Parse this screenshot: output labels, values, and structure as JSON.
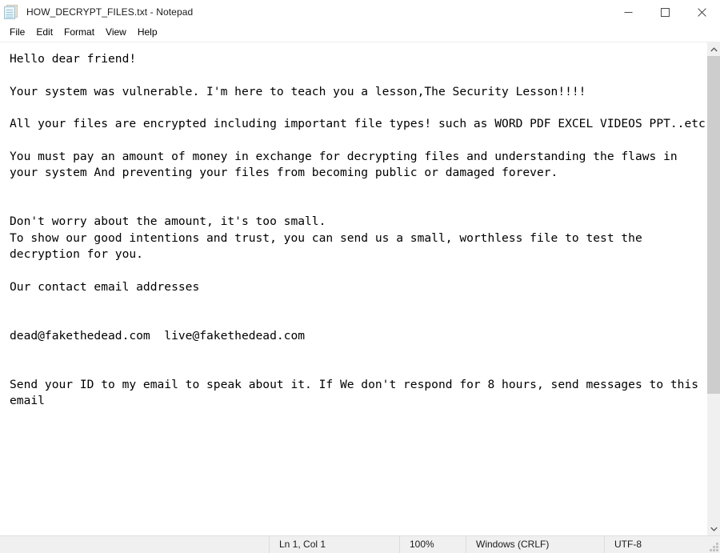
{
  "window": {
    "title": "HOW_DECRYPT_FILES.txt - Notepad",
    "icon": "notepad-icon",
    "controls": [
      {
        "name": "minimize",
        "glyph": "minimize-icon"
      },
      {
        "name": "maximize",
        "glyph": "maximize-icon"
      },
      {
        "name": "close",
        "glyph": "close-icon"
      }
    ]
  },
  "menubar": {
    "items": [
      {
        "label": "File"
      },
      {
        "label": "Edit"
      },
      {
        "label": "Format"
      },
      {
        "label": "View"
      },
      {
        "label": "Help"
      }
    ]
  },
  "document": {
    "body": "Hello dear friend!\n\nYour system was vulnerable. I'm here to teach you a lesson,The Security Lesson!!!!\n\nAll your files are encrypted including important file types! such as WORD PDF EXCEL VIDEOS PPT..etc\n\nYou must pay an amount of money in exchange for decrypting files and understanding the flaws in your system And preventing your files from becoming public or damaged forever.\n\n\nDon't worry about the amount, it's too small.\nTo show our good intentions and trust, you can send us a small, worthless file to test the decryption for you.\n\nOur contact email addresses\n\n\ndead@fakethedead.com  live@fakethedead.com\n\n\nSend your ID to my email to speak about it. If We don't respond for 8 hours, send messages to this email",
    "emails": [
      "dead@fakethedead.com",
      "live@fakethedead.com"
    ]
  },
  "scrollbar": {
    "up_arrow": "chevron-up-icon",
    "down_arrow": "chevron-down-icon",
    "thumb_percent": "72.5"
  },
  "statusbar": {
    "cursor_position": "Ln 1, Col 1",
    "zoom_level": "100%",
    "line_ending": "Windows (CRLF)",
    "encoding": "UTF-8"
  },
  "colors": {
    "titlebar_bg": "#ffffff",
    "statusbar_bg": "#f0f0f0",
    "text_fg": "#000000",
    "scroll_thumb": "#cdcdcd",
    "close_hover": "#e81123"
  }
}
